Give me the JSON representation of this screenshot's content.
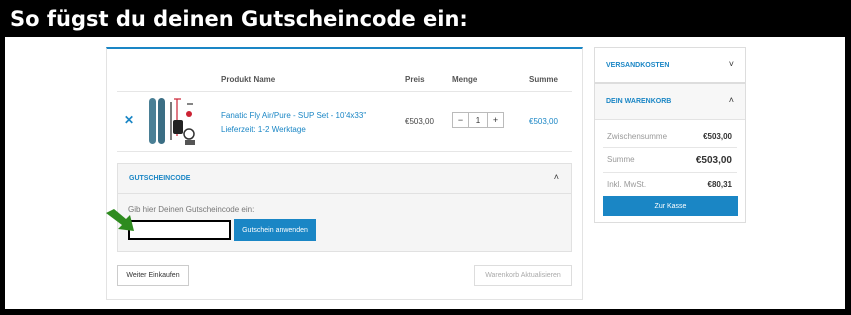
{
  "banner": {
    "title": "So fügst du deinen Gutscheincode ein:"
  },
  "cart": {
    "headers": {
      "product": "Produkt Name",
      "price": "Preis",
      "quantity": "Menge",
      "total": "Summe"
    },
    "item": {
      "remove_icon": "close-icon",
      "name": "Fanatic Fly Air/Pure - SUP Set - 10'4x33\"",
      "shipping": "Lieferzeit: 1-2 Werktage",
      "price": "€503,00",
      "quantity": "1",
      "minus": "−",
      "plus": "+",
      "total": "€503,00"
    },
    "coupon": {
      "title": "GUTSCHEINCODE",
      "label": "Gib hier Deinen Gutscheincode ein:",
      "input_value": "",
      "apply_label": "Gutschein anwenden",
      "chevron_icon": "chevron-up-icon"
    },
    "continue_label": "Weiter Einkaufen",
    "update_label": "Warenkorb Aktualisieren"
  },
  "sidebar": {
    "shipping": {
      "title": "VERSANDKOSTEN",
      "chevron_icon": "chevron-down-icon"
    },
    "cart": {
      "title": "DEIN WARENKORB",
      "chevron_icon": "chevron-up-icon",
      "rows": [
        {
          "label": "Zwischensumme",
          "value": "€503,00"
        },
        {
          "label": "Summe",
          "value": "€503,00"
        },
        {
          "label": "Inkl. MwSt.",
          "value": "€80,31"
        }
      ],
      "checkout_label": "Zur Kasse"
    }
  },
  "colors": {
    "accent": "#1a86c5",
    "arrow": "#2e8b1f",
    "banner_bg": "#000000"
  }
}
